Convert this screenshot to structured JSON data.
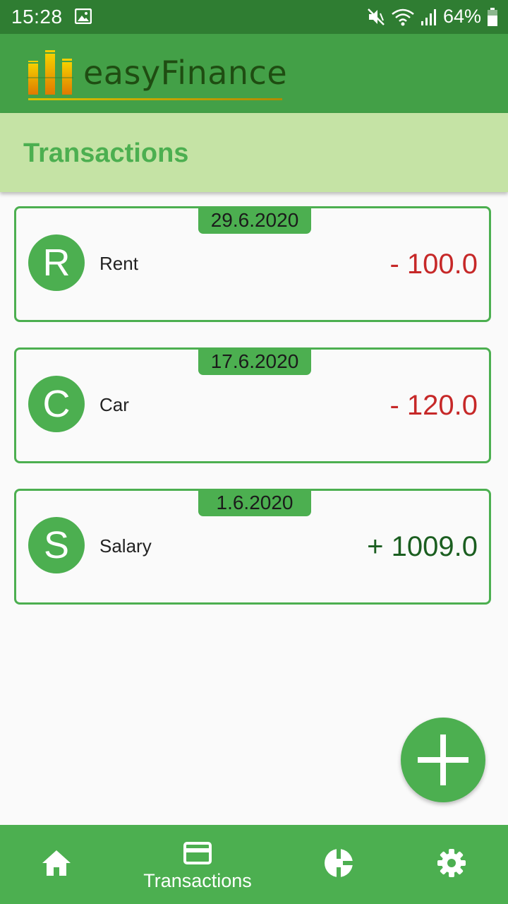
{
  "status_bar": {
    "time": "15:28",
    "battery": "64%"
  },
  "app": {
    "logo_text": "easyFinance",
    "colors": {
      "primary": "#4caf50",
      "dark": "#2f7d32",
      "light": "#c5e3a5",
      "negative": "#c62828",
      "positive": "#1b5e20"
    }
  },
  "header": {
    "title": "Transactions"
  },
  "transactions": [
    {
      "date": "29.6.2020",
      "initial": "R",
      "name": "Rent",
      "amount": "- 100.0",
      "type": "expense"
    },
    {
      "date": "17.6.2020",
      "initial": "C",
      "name": "Car",
      "amount": "- 120.0",
      "type": "expense"
    },
    {
      "date": "1.6.2020",
      "initial": "S",
      "name": "Salary",
      "amount": "+ 1009.0",
      "type": "income"
    }
  ],
  "fab": {
    "icon": "plus-icon"
  },
  "bottom_nav": {
    "items": [
      {
        "icon": "home-icon",
        "label": ""
      },
      {
        "icon": "credit-card-icon",
        "label": "Transactions",
        "active": true
      },
      {
        "icon": "pie-chart-icon",
        "label": ""
      },
      {
        "icon": "gear-icon",
        "label": ""
      }
    ]
  }
}
